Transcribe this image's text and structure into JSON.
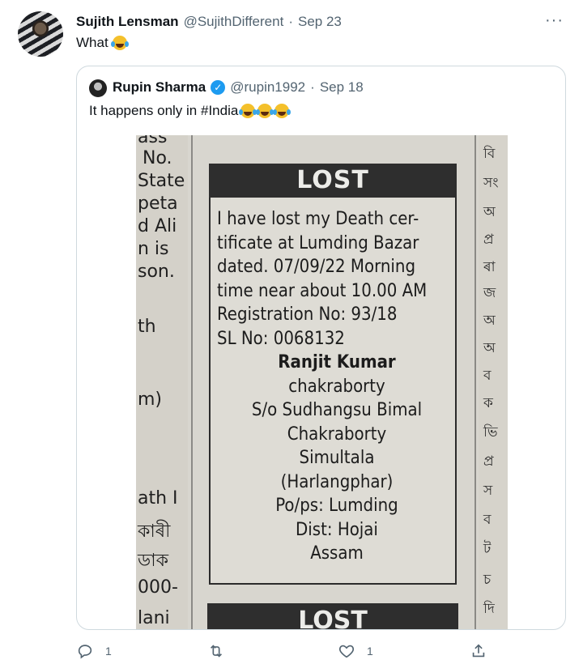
{
  "tweet": {
    "author_name": "Sujith Lensman",
    "handle": "@SujithDifferent",
    "separator": "·",
    "date": "Sep 23",
    "more": "···",
    "text": "What"
  },
  "quote": {
    "author_name": "Rupin Sharma",
    "handle": "@rupin1992",
    "separator": "·",
    "date": "Sep 18",
    "text": "It happens only in #India"
  },
  "media": {
    "left_column": [
      "ass",
      "No.",
      "State",
      "peta",
      "d Ali",
      "n is",
      "son.",
      "th",
      "m)",
      "ath I",
      "কাৰী",
      "ডাক",
      "000-",
      "lani"
    ],
    "right_column": [
      "বি",
      "সং",
      "অ",
      "প্র",
      "ৰা",
      "জ",
      "অ",
      "অ",
      "ব",
      "ক",
      "ভি",
      "প্র",
      "স",
      "ব",
      "ট",
      "চ",
      "দি"
    ],
    "ad_title": "LOST",
    "ad_lines": [
      "I have lost my Death cer-",
      "tificate at Lumding Bazar",
      "dated. 07/09/22 Morning",
      "time near about 10.00 AM",
      "Registration No: 93/18",
      "SL No: 0068132"
    ],
    "ad_name_lines": [
      "Ranjit Kumar",
      "chakraborty",
      "S/o Sudhangsu Bimal",
      "Chakraborty",
      "Simultala",
      "(Harlangphar)",
      "Po/ps: Lumding",
      "Dist: Hojai",
      "Assam"
    ],
    "ad2_title": "LOST"
  },
  "actions": {
    "reply_count": "1",
    "retweet_count": "",
    "like_count": "1"
  },
  "colors": {
    "text_primary": "#0f1419",
    "text_secondary": "#536471",
    "verified": "#1d9bf0",
    "border": "#cfd9de"
  }
}
